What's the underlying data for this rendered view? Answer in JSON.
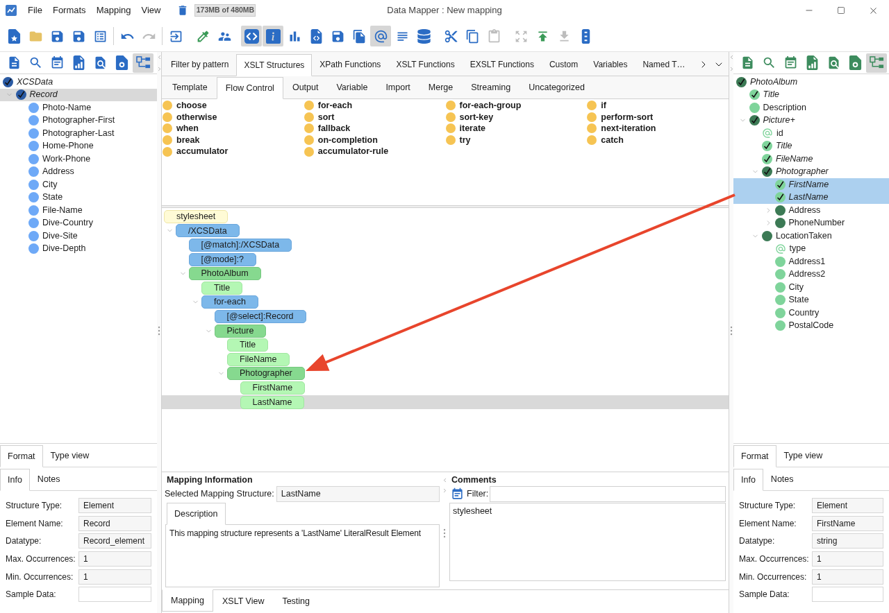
{
  "window": {
    "title": "Data Mapper : New mapping",
    "memory": "173MB of 480MB"
  },
  "menu": [
    {
      "label": "File"
    },
    {
      "label": "Formats"
    },
    {
      "label": "Mapping"
    },
    {
      "label": "View"
    }
  ],
  "toolbar": {
    "groups": [
      [
        {
          "pressed": false,
          "disabled": false
        },
        {
          "pressed": false,
          "disabled": false
        },
        {
          "pressed": false,
          "disabled": false
        },
        {
          "pressed": false,
          "disabled": false
        },
        {
          "pressed": false,
          "disabled": false
        }
      ],
      [
        {
          "pressed": false,
          "disabled": false
        },
        {
          "pressed": false,
          "disabled": true
        }
      ],
      [
        {
          "pressed": false,
          "disabled": false
        }
      ],
      [
        {
          "pressed": false,
          "disabled": false
        },
        {
          "pressed": false,
          "disabled": false
        }
      ],
      [
        {
          "pressed": true,
          "disabled": false
        },
        {
          "pressed": true,
          "disabled": false
        },
        {
          "pressed": false,
          "disabled": false
        },
        {
          "pressed": false,
          "disabled": false
        },
        {
          "pressed": false,
          "disabled": false
        },
        {
          "pressed": false,
          "disabled": false
        },
        {
          "pressed": true,
          "disabled": false
        },
        {
          "pressed": false,
          "disabled": false
        },
        {
          "pressed": false,
          "disabled": false
        }
      ],
      [
        {
          "pressed": false,
          "disabled": false
        },
        {
          "pressed": false,
          "disabled": false
        },
        {
          "pressed": false,
          "disabled": true
        }
      ],
      [
        {
          "pressed": false,
          "disabled": true
        },
        {
          "pressed": false,
          "disabled": false
        },
        {
          "pressed": false,
          "disabled": true
        },
        {
          "pressed": false,
          "disabled": false
        }
      ]
    ]
  },
  "source": {
    "toolbar": [
      {
        "pressed": false
      },
      {
        "pressed": false
      },
      {
        "pressed": false
      },
      {
        "pressed": false
      },
      {
        "pressed": false
      },
      {
        "pressed": false
      },
      {
        "pressed": true
      }
    ],
    "focused": false,
    "tree": [
      {
        "label": "XCSData",
        "kind": "complex",
        "mapped": true,
        "selected": false,
        "children": [
          {
            "label": "Record",
            "kind": "complex",
            "mapped": true,
            "selected": true,
            "expanded": true,
            "children": [
              {
                "label": "Photo-Name",
                "kind": "simple",
                "mapped": false,
                "selected": false
              },
              {
                "label": "Photographer-First",
                "kind": "simple",
                "mapped": false,
                "selected": false
              },
              {
                "label": "Photographer-Last",
                "kind": "simple",
                "mapped": false,
                "selected": false
              },
              {
                "label": "Home-Phone",
                "kind": "simple",
                "mapped": false,
                "selected": false
              },
              {
                "label": "Work-Phone",
                "kind": "simple",
                "mapped": false,
                "selected": false
              },
              {
                "label": "Address",
                "kind": "simple",
                "mapped": false,
                "selected": false
              },
              {
                "label": "City",
                "kind": "simple",
                "mapped": false,
                "selected": false
              },
              {
                "label": "State",
                "kind": "simple",
                "mapped": false,
                "selected": false
              },
              {
                "label": "File-Name",
                "kind": "simple",
                "mapped": false,
                "selected": false
              },
              {
                "label": "Dive-Country",
                "kind": "simple",
                "mapped": false,
                "selected": false
              },
              {
                "label": "Dive-Site",
                "kind": "simple",
                "mapped": false,
                "selected": false
              },
              {
                "label": "Dive-Depth",
                "kind": "simple",
                "mapped": false,
                "selected": false
              }
            ]
          }
        ]
      }
    ],
    "tabs": [
      {
        "label": "Format",
        "selected": true
      },
      {
        "label": "Type view",
        "selected": false
      }
    ],
    "info_tabs": [
      {
        "label": "Info",
        "selected": true
      },
      {
        "label": "Notes",
        "selected": false
      }
    ],
    "properties": [
      {
        "label": "Structure Type:",
        "value": "Element"
      },
      {
        "label": "Element Name:",
        "value": "Record"
      },
      {
        "label": "Datatype:",
        "value": "Record_element"
      },
      {
        "label": "Max. Occurrences:",
        "value": "1"
      },
      {
        "label": "Min. Occurrences:",
        "value": "1"
      },
      {
        "label": "Sample Data:"
      }
    ]
  },
  "palette": {
    "tabs": [
      {
        "label": "Filter by pattern",
        "selected": false
      },
      {
        "label": "XSLT Structures",
        "selected": true
      },
      {
        "label": "XPath Functions",
        "selected": false
      },
      {
        "label": "XSLT Functions",
        "selected": false
      },
      {
        "label": "EXSLT Functions",
        "selected": false
      },
      {
        "label": "Custom",
        "selected": false
      },
      {
        "label": "Variables",
        "selected": false
      },
      {
        "label": "Named T…",
        "selected": false
      }
    ],
    "subtabs": [
      {
        "label": "Template",
        "selected": false
      },
      {
        "label": "Flow Control",
        "selected": true
      },
      {
        "label": "Output",
        "selected": false
      },
      {
        "label": "Variable",
        "selected": false
      },
      {
        "label": "Import",
        "selected": false
      },
      {
        "label": "Merge",
        "selected": false
      },
      {
        "label": "Streaming",
        "selected": false
      },
      {
        "label": "Uncategorized",
        "selected": false
      }
    ],
    "columns": [
      {
        "items": [
          "choose",
          "otherwise",
          "when",
          "break",
          "accumulator"
        ]
      },
      {
        "items": [
          "for-each",
          "sort",
          "fallback",
          "on-completion",
          "accumulator-rule"
        ]
      },
      {
        "items": [
          "for-each-group",
          "sort-key",
          "iterate",
          "try"
        ]
      },
      {
        "items": [
          "if",
          "perform-sort",
          "next-iteration",
          "catch"
        ]
      }
    ]
  },
  "mapping": {
    "focused": false,
    "nodes": [
      {
        "label": "stylesheet",
        "kind": "stylesheet",
        "selected": false
      },
      {
        "label": "/XCSData",
        "kind": "instruction",
        "selected": false,
        "expanded": true,
        "children": [
          {
            "label": "[@match]:/XCSData",
            "kind": "instruction",
            "selected": false
          },
          {
            "label": "[@mode]:?",
            "kind": "instruction",
            "selected": false
          },
          {
            "label": "PhotoAlbum",
            "kind": "element",
            "selected": false,
            "expanded": true,
            "children": [
              {
                "label": "Title",
                "kind": "leaf",
                "selected": false
              },
              {
                "label": "for-each",
                "kind": "instruction",
                "selected": false,
                "expanded": true,
                "children": [
                  {
                    "label": "[@select]:Record",
                    "kind": "instruction",
                    "selected": false
                  },
                  {
                    "label": "Picture",
                    "kind": "element",
                    "selected": false,
                    "expanded": true,
                    "children": [
                      {
                        "label": "Title",
                        "kind": "leaf",
                        "selected": false
                      },
                      {
                        "label": "FileName",
                        "kind": "leaf",
                        "selected": false
                      },
                      {
                        "label": "Photographer",
                        "kind": "element",
                        "selected": false,
                        "expanded": true,
                        "children": [
                          {
                            "label": "FirstName",
                            "kind": "leaf",
                            "selected": false
                          },
                          {
                            "label": "LastName",
                            "kind": "leaf",
                            "selected": true
                          }
                        ]
                      }
                    ]
                  }
                ]
              }
            ]
          }
        ]
      }
    ]
  },
  "mapping_info": {
    "title": "Mapping Information",
    "field_label": "Selected Mapping Structure:",
    "field_value": "LastName",
    "tabs": [
      {
        "label": "Description",
        "selected": true
      }
    ],
    "description": "This mapping structure represents a 'LastName' LiteralResult Element"
  },
  "comments": {
    "title": "Comments",
    "filter_label": "Filter:",
    "entries": [
      "stylesheet"
    ]
  },
  "view_tabs": [
    {
      "label": "Mapping",
      "selected": true
    },
    {
      "label": "XSLT View",
      "selected": false
    },
    {
      "label": "Testing",
      "selected": false
    }
  ],
  "target": {
    "toolbar": [
      {
        "pressed": false
      },
      {
        "pressed": false
      },
      {
        "pressed": false
      },
      {
        "pressed": false
      },
      {
        "pressed": false
      },
      {
        "pressed": false
      },
      {
        "pressed": true
      }
    ],
    "focused": true,
    "tree": [
      {
        "label": "PhotoAlbum",
        "kind": "complex",
        "mapped": true,
        "selected": false,
        "children": [
          {
            "label": "Title",
            "kind": "simple",
            "mapped": true,
            "selected": false
          },
          {
            "label": "Description",
            "kind": "simple",
            "mapped": false,
            "selected": false
          },
          {
            "label": "Picture+",
            "kind": "complex",
            "mapped": true,
            "selected": false,
            "expanded": true,
            "children": [
              {
                "label": "id",
                "kind": "attribute",
                "mapped": false,
                "selected": false
              },
              {
                "label": "Title",
                "kind": "simple",
                "mapped": true,
                "selected": false
              },
              {
                "label": "FileName",
                "kind": "simple",
                "mapped": true,
                "selected": false
              },
              {
                "label": "Photographer",
                "kind": "complex",
                "mapped": true,
                "selected": false,
                "expanded": true,
                "children": [
                  {
                    "label": "FirstName",
                    "kind": "simple",
                    "mapped": true,
                    "selected": true
                  },
                  {
                    "label": "LastName",
                    "kind": "simple",
                    "mapped": true,
                    "selected": true
                  },
                  {
                    "label": "Address",
                    "kind": "complex",
                    "mapped": false,
                    "selected": false,
                    "expanded": false
                  },
                  {
                    "label": "PhoneNumber",
                    "kind": "complex",
                    "mapped": false,
                    "selected": false,
                    "expanded": false
                  }
                ]
              },
              {
                "label": "LocationTaken",
                "kind": "complex",
                "mapped": false,
                "selected": false,
                "expanded": true,
                "children": [
                  {
                    "label": "type",
                    "kind": "attribute",
                    "mapped": false,
                    "selected": false
                  },
                  {
                    "label": "Address1",
                    "kind": "simple",
                    "mapped": false,
                    "selected": false
                  },
                  {
                    "label": "Address2",
                    "kind": "simple",
                    "mapped": false,
                    "selected": false
                  },
                  {
                    "label": "City",
                    "kind": "simple",
                    "mapped": false,
                    "selected": false
                  },
                  {
                    "label": "State",
                    "kind": "simple",
                    "mapped": false,
                    "selected": false
                  },
                  {
                    "label": "Country",
                    "kind": "simple",
                    "mapped": false,
                    "selected": false
                  },
                  {
                    "label": "PostalCode",
                    "kind": "simple",
                    "mapped": false,
                    "selected": false
                  }
                ]
              }
            ]
          }
        ]
      }
    ],
    "tabs": [
      {
        "label": "Format",
        "selected": true
      },
      {
        "label": "Type view",
        "selected": false
      }
    ],
    "info_tabs": [
      {
        "label": "Info",
        "selected": true
      },
      {
        "label": "Notes",
        "selected": false
      }
    ],
    "properties": [
      {
        "label": "Structure Type:",
        "value": "Element"
      },
      {
        "label": "Element Name:",
        "value": "FirstName"
      },
      {
        "label": "Datatype:",
        "value": "string"
      },
      {
        "label": "Max. Occurrences:",
        "value": "1"
      },
      {
        "label": "Min. Occurrences:",
        "value": "1"
      },
      {
        "label": "Sample Data:"
      }
    ]
  }
}
